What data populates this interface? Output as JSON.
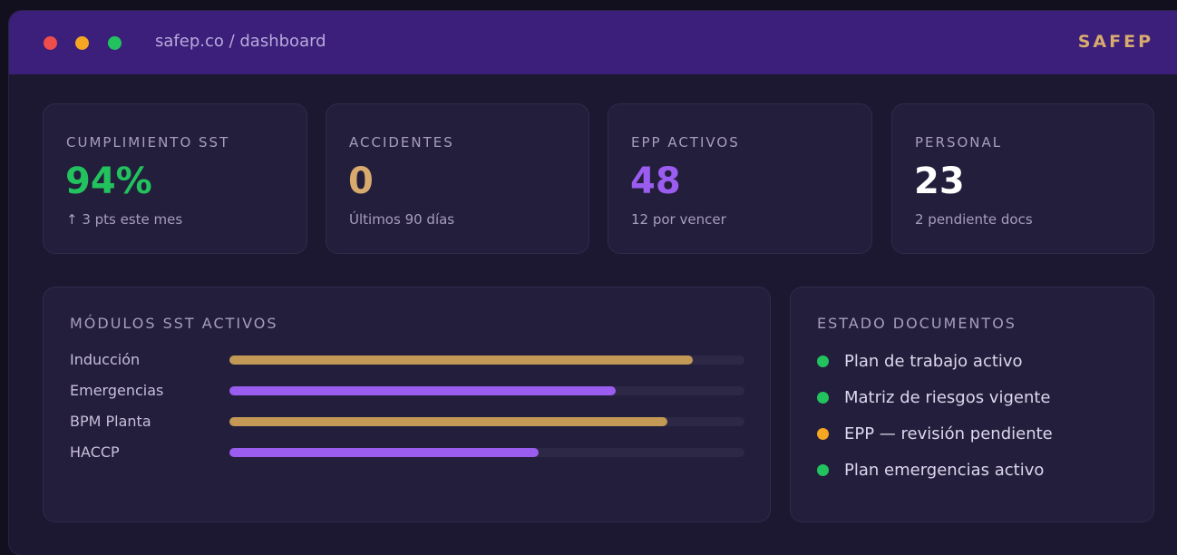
{
  "window": {
    "url": "safep.co / dashboard",
    "brand": "SAFEP",
    "dots": [
      {
        "name": "close",
        "color": "#ef4c4c"
      },
      {
        "name": "minimize",
        "color": "#f5a623"
      },
      {
        "name": "maximize",
        "color": "#22c35e"
      }
    ]
  },
  "stats": [
    {
      "label": "CUMPLIMIENTO SST",
      "value": "94%",
      "sub": "↑ 3 pts este mes",
      "color": "#22c35e"
    },
    {
      "label": "ACCIDENTES",
      "value": "0",
      "sub": "Últimos 90 días",
      "color": "#d8aa6e"
    },
    {
      "label": "EPP ACTIVOS",
      "value": "48",
      "sub": "12 por vencer",
      "color": "#9b5cf0"
    },
    {
      "label": "PERSONAL",
      "value": "23",
      "sub": "2 pendiente docs",
      "color": "#ffffff"
    }
  ],
  "modules": {
    "title": "MÓDULOS SST ACTIVOS",
    "items": [
      {
        "label": "Inducción",
        "progress": 0.9,
        "color": "#c29a55"
      },
      {
        "label": "Emergencias",
        "progress": 0.75,
        "color": "#9b5cf0"
      },
      {
        "label": "BPM Planta",
        "progress": 0.85,
        "color": "#c29a55"
      },
      {
        "label": "HACCP",
        "progress": 0.6,
        "color": "#9b5cf0"
      }
    ]
  },
  "documents": {
    "title": "ESTADO DOCUMENTOS",
    "items": [
      {
        "label": "Plan de trabajo activo",
        "status_color": "#22c35e"
      },
      {
        "label": "Matriz de riesgos vigente",
        "status_color": "#22c35e"
      },
      {
        "label": "EPP — revisión pendiente",
        "status_color": "#f5a623"
      },
      {
        "label": "Plan emergencias activo",
        "status_color": "#22c35e"
      }
    ]
  }
}
